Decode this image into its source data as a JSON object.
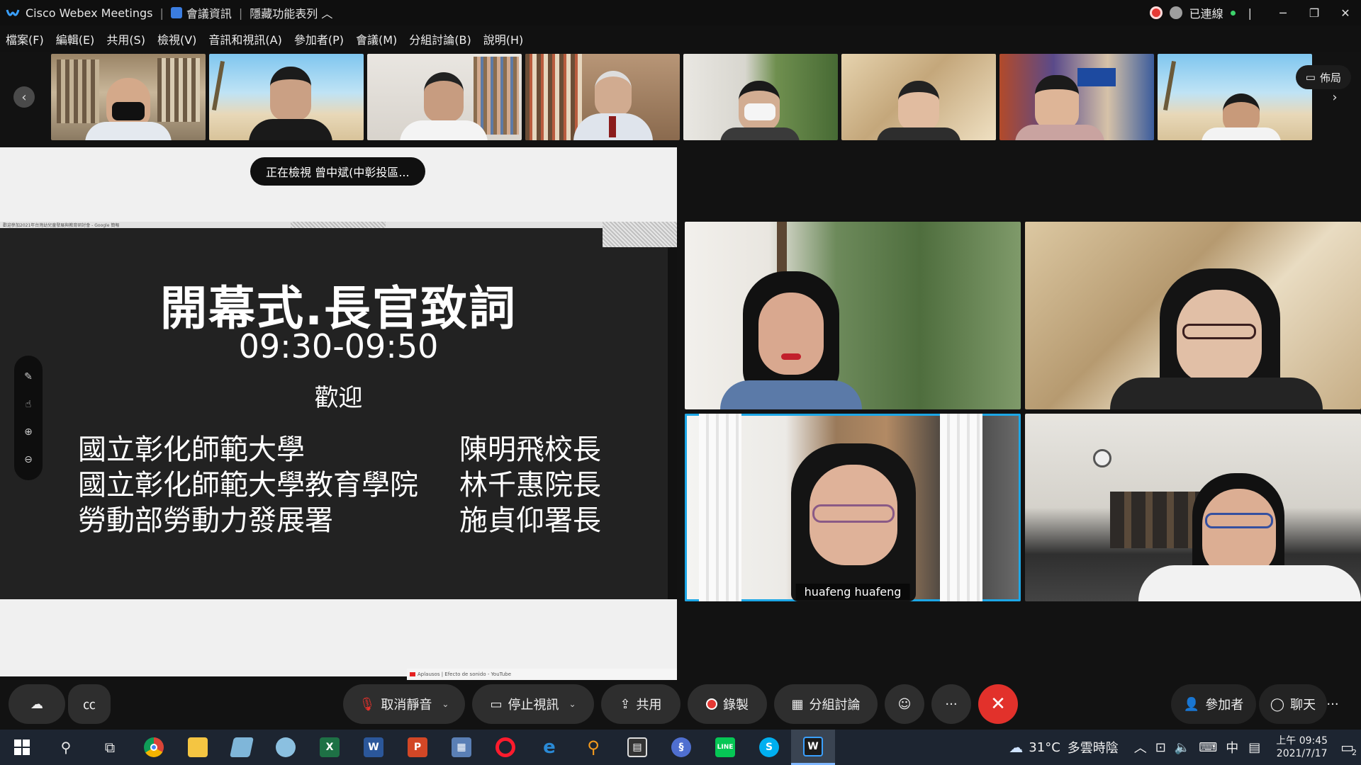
{
  "titlebar": {
    "app_name": "Cisco Webex Meetings",
    "meeting_info": "會議資訊",
    "hide_menu": "隱藏功能表列",
    "connection_status": "已連線",
    "colors": {
      "accent": "#1da7e6",
      "record": "#e53935",
      "connected": "#3dd26b"
    }
  },
  "menu": [
    "檔案(F)",
    "編輯(E)",
    "共用(S)",
    "檢視(V)",
    "音訊和視訊(A)",
    "參加者(P)",
    "會議(M)",
    "分組討論(B)",
    "說明(H)"
  ],
  "strip": {
    "layout_label": "佈局",
    "thumbnails": [
      "participant-1",
      "participant-2",
      "participant-3",
      "participant-4",
      "participant-5",
      "participant-6",
      "participant-7",
      "participant-8"
    ]
  },
  "share": {
    "viewing_label": "正在檢視 曾中斌(中彰投區...",
    "browser_tab_text": "歡迎參加2021年台灣幼兒童發展與教育研討會 - Google 簡報",
    "youtube_tab_text": "Aplausos | Efecto de sonido - YouTube",
    "slide": {
      "title": "開幕式.長官致詞",
      "time": "09:30-09:50",
      "welcome": "歡迎",
      "rows": [
        {
          "org": "國立彰化師範大學",
          "person": "陳明飛校長"
        },
        {
          "org": "國立彰化師範大學教育學院",
          "person": "林千惠院長"
        },
        {
          "org": "勞動部勞動力發展署",
          "person": "施貞仰署長"
        }
      ]
    }
  },
  "video_grid": {
    "active_speaker_name": "huafeng huafeng"
  },
  "controls": {
    "unmute": "取消靜音",
    "stop_video": "停止視訊",
    "share": "共用",
    "record": "錄製",
    "breakout": "分組討論",
    "participants": "參加者",
    "chat": "聊天",
    "more": "···"
  },
  "taskbar": {
    "weather_temp": "31°C",
    "weather_text": "多雲時陰",
    "ime": "中",
    "time": "上午 09:45",
    "date": "2021/7/17",
    "notification_count": "2"
  }
}
